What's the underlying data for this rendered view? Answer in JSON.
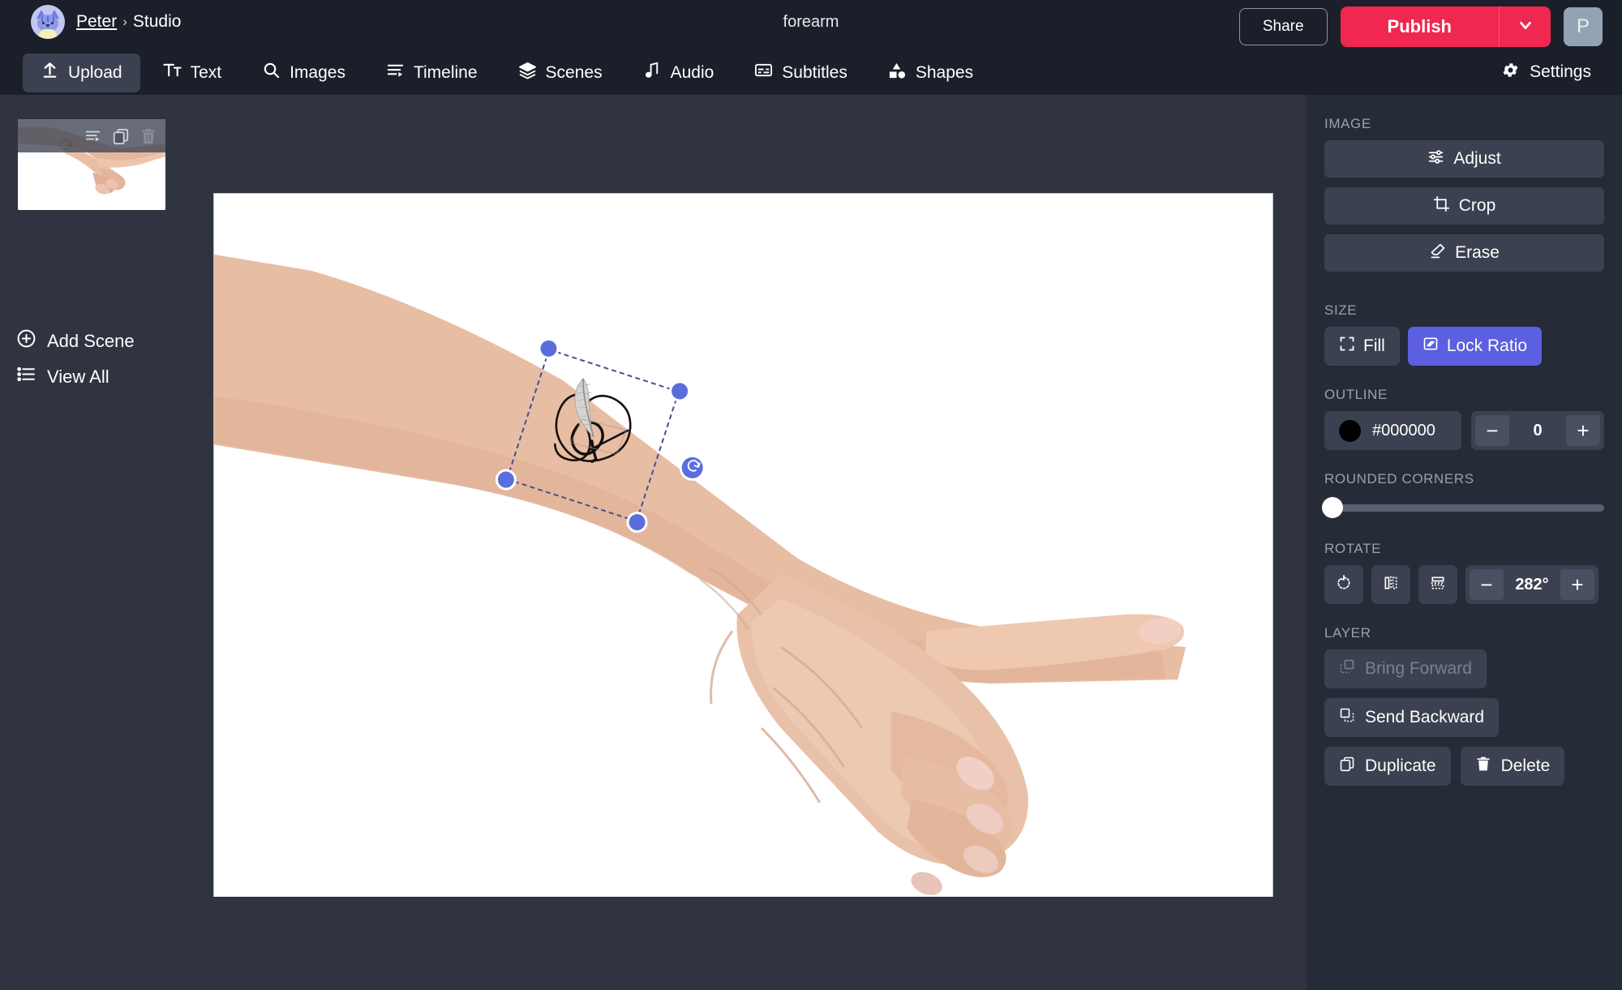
{
  "topbar": {
    "breadcrumb_user": "Peter",
    "breadcrumb_sep": "›",
    "breadcrumb_section": "Studio",
    "document_title": "forearm",
    "share_label": "Share",
    "publish_label": "Publish",
    "user_initial": "P",
    "publish_color": "#f0274f"
  },
  "nav": {
    "items": [
      {
        "label": "Upload",
        "icon": "upload-icon",
        "active": true
      },
      {
        "label": "Text",
        "icon": "text-icon",
        "active": false
      },
      {
        "label": "Images",
        "icon": "search-icon",
        "active": false
      },
      {
        "label": "Timeline",
        "icon": "timeline-icon",
        "active": false
      },
      {
        "label": "Scenes",
        "icon": "layers-icon",
        "active": false
      },
      {
        "label": "Audio",
        "icon": "music-note-icon",
        "active": false
      },
      {
        "label": "Subtitles",
        "icon": "subtitles-icon",
        "active": false
      },
      {
        "label": "Shapes",
        "icon": "shapes-icon",
        "active": false
      }
    ],
    "settings_label": "Settings"
  },
  "sidebar": {
    "scene_tools": [
      "reorder-icon",
      "duplicate-icon",
      "trash-icon"
    ],
    "add_scene_label": "Add Scene",
    "view_all_label": "View All"
  },
  "panel": {
    "image": {
      "section_label": "IMAGE",
      "buttons": [
        {
          "label": "Adjust",
          "icon": "sliders-icon"
        },
        {
          "label": "Crop",
          "icon": "crop-icon"
        },
        {
          "label": "Erase",
          "icon": "eraser-icon"
        }
      ]
    },
    "size": {
      "section_label": "SIZE",
      "fill_label": "Fill",
      "lock_ratio_label": "Lock Ratio",
      "lock_ratio_active": true,
      "accent_color": "#5b5fe0"
    },
    "outline": {
      "section_label": "OUTLINE",
      "color_hex": "#000000",
      "width_value": "0",
      "minus_label": "−",
      "plus_label": "+"
    },
    "rounded_corners": {
      "section_label": "ROUNDED CORNERS",
      "value": 0
    },
    "rotate": {
      "section_label": "ROTATE",
      "angle_value": "282°",
      "minus_label": "−",
      "plus_label": "+",
      "tools": [
        "rotate-cw-icon",
        "flip-horizontal-icon",
        "flip-vertical-icon"
      ]
    },
    "layer": {
      "section_label": "LAYER",
      "bring_forward_label": "Bring Forward",
      "bring_forward_disabled": true,
      "send_backward_label": "Send Backward",
      "duplicate_label": "Duplicate",
      "delete_label": "Delete"
    }
  },
  "canvas": {
    "selection": {
      "rotation_deg": 282,
      "handles": [
        "top-left",
        "top-right",
        "bottom-left",
        "bottom-right"
      ],
      "rotate_handle": "rotate-handle"
    }
  }
}
